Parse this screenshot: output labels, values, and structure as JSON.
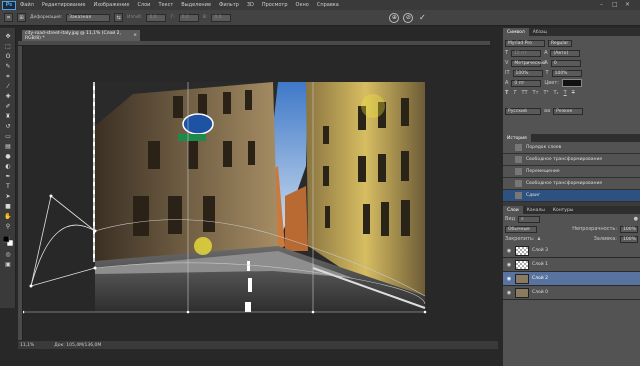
{
  "menu": {
    "logo": "Ps",
    "items": [
      "Файл",
      "Редактирование",
      "Изображение",
      "Слои",
      "Текст",
      "Выделение",
      "Фильтр",
      "3D",
      "Просмотр",
      "Окно",
      "Справка"
    ],
    "controls": [
      "–",
      "□",
      "✕"
    ]
  },
  "options": {
    "deform_label": "Деформация:",
    "deform_value": "Заказная",
    "bend_label": "Изгиб:",
    "bend_value": "0,0",
    "h_label": "Г:",
    "h_value": "0,0",
    "v_label": "В:",
    "v_value": "0,0"
  },
  "document": {
    "tab_title": "city-road-street-italy.jpg @ 11,1% (Слой 2, RGB/8) *",
    "tab_close": "×",
    "zoom": "11,1%",
    "doc_info": "Док: 105,4M/136,0M"
  },
  "panels": {
    "char_tabs": [
      "Символ",
      "Абзац"
    ],
    "font_family": "Myriad Pro",
    "font_style": "Regular",
    "font_size": "12 пт",
    "leading": "(Авто)",
    "kerning": "Метрический",
    "tracking": "0",
    "vscale": "100%",
    "hscale": "100%",
    "baseline": "0 пт",
    "color_label": "Цвет:",
    "color_swatch": "#111111",
    "lang": "Русский",
    "aa": "Резкое",
    "text_style_buttons": [
      "T",
      "T",
      "TT",
      "Tт",
      "T¹",
      "T₁",
      "T",
      "T"
    ],
    "history_tab": "История",
    "history": [
      {
        "label": "Порядок слоев",
        "selected": false
      },
      {
        "label": "Свободное трансформирование",
        "selected": false
      },
      {
        "label": "Перемещение",
        "selected": false
      },
      {
        "label": "Свободное трансформирование",
        "selected": false
      },
      {
        "label": "Сдвиг",
        "selected": true
      }
    ],
    "layers_tabs": [
      "Слои",
      "Каналы",
      "Контуры"
    ],
    "blend_mode": "Обычные",
    "opacity_label": "Непрозрачность:",
    "opacity": "100%",
    "lock_label": "Закрепить:",
    "fill_label": "Заливка:",
    "fill": "100%",
    "kind_label": "Вид",
    "layers": [
      {
        "name": "Слой 3",
        "selected": false,
        "thumb": "trans"
      },
      {
        "name": "Слой 1",
        "selected": false,
        "thumb": "trans"
      },
      {
        "name": "Слой 2",
        "selected": true,
        "thumb": "img"
      },
      {
        "name": "Слой 0",
        "selected": false,
        "thumb": "img"
      }
    ]
  },
  "colors": {
    "accent_select": "#2d5281",
    "layer_select": "#5873a0",
    "ps_blue": "#4fa3e3"
  }
}
